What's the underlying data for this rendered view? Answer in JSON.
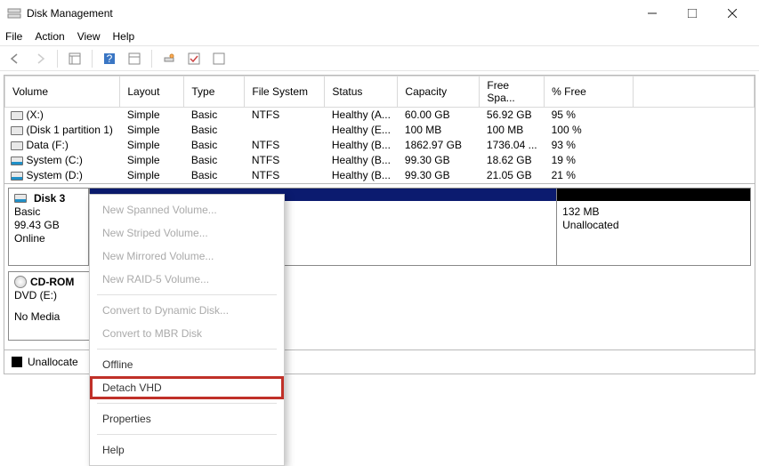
{
  "window": {
    "title": "Disk Management"
  },
  "menu": {
    "file": "File",
    "action": "Action",
    "view": "View",
    "help": "Help"
  },
  "table": {
    "headers": {
      "volume": "Volume",
      "layout": "Layout",
      "type": "Type",
      "fs": "File System",
      "status": "Status",
      "capacity": "Capacity",
      "free": "Free Spa...",
      "pct": "% Free"
    },
    "rows": [
      {
        "icon": "gray",
        "volume": "(X:)",
        "layout": "Simple",
        "type": "Basic",
        "fs": "NTFS",
        "status": "Healthy (A...",
        "capacity": "60.00 GB",
        "free": "56.92 GB",
        "pct": "95 %"
      },
      {
        "icon": "gray",
        "volume": "(Disk 1 partition 1)",
        "layout": "Simple",
        "type": "Basic",
        "fs": "",
        "status": "Healthy (E...",
        "capacity": "100 MB",
        "free": "100 MB",
        "pct": "100 %"
      },
      {
        "icon": "gray",
        "volume": "Data (F:)",
        "layout": "Simple",
        "type": "Basic",
        "fs": "NTFS",
        "status": "Healthy (B...",
        "capacity": "1862.97 GB",
        "free": "1736.04 ...",
        "pct": "93 %"
      },
      {
        "icon": "blue",
        "volume": "System (C:)",
        "layout": "Simple",
        "type": "Basic",
        "fs": "NTFS",
        "status": "Healthy (B...",
        "capacity": "99.30 GB",
        "free": "18.62 GB",
        "pct": "19 %"
      },
      {
        "icon": "blue",
        "volume": "System (D:)",
        "layout": "Simple",
        "type": "Basic",
        "fs": "NTFS",
        "status": "Healthy (B...",
        "capacity": "99.30 GB",
        "free": "21.05 GB",
        "pct": "21 %"
      }
    ]
  },
  "disk3": {
    "name": "Disk 3",
    "type": "Basic",
    "size": "99.43 GB",
    "status": "Online"
  },
  "part_unalloc": {
    "size": "132 MB",
    "label": "Unallocated"
  },
  "cdrom": {
    "name": "CD-ROM",
    "letter": "DVD (E:)",
    "status": "No Media"
  },
  "legend": {
    "unalloc": "Unallocate"
  },
  "ctx": {
    "spanned": "New Spanned Volume...",
    "striped": "New Striped Volume...",
    "mirrored": "New Mirrored Volume...",
    "raid5": "New RAID-5 Volume...",
    "dynamic": "Convert to Dynamic Disk...",
    "mbr": "Convert to MBR Disk",
    "offline": "Offline",
    "detach": "Detach VHD",
    "properties": "Properties",
    "help": "Help"
  }
}
